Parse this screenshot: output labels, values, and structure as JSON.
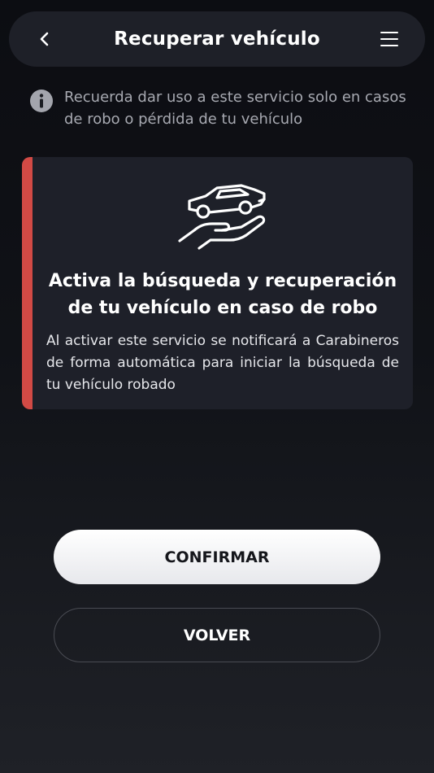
{
  "header": {
    "title": "Recuperar vehículo",
    "back_icon": "chevron-left-icon",
    "menu_icon": "hamburger-menu-icon"
  },
  "notice": {
    "icon": "info-icon",
    "text": "Recuerda dar uso a este servicio solo en casos de robo o pérdida de tu vehículo"
  },
  "card": {
    "illustration": "car-on-hand-icon",
    "accent_color": "#d24a45",
    "title": "Activa la búsqueda y recuperación de tu vehículo en caso de robo",
    "text": "Al activar este servicio se notificará a Carabineros de forma automática para iniciar la búsqueda de tu vehículo robado"
  },
  "actions": {
    "confirm_label": "CONFIRMAR",
    "back_label": "VOLVER"
  }
}
